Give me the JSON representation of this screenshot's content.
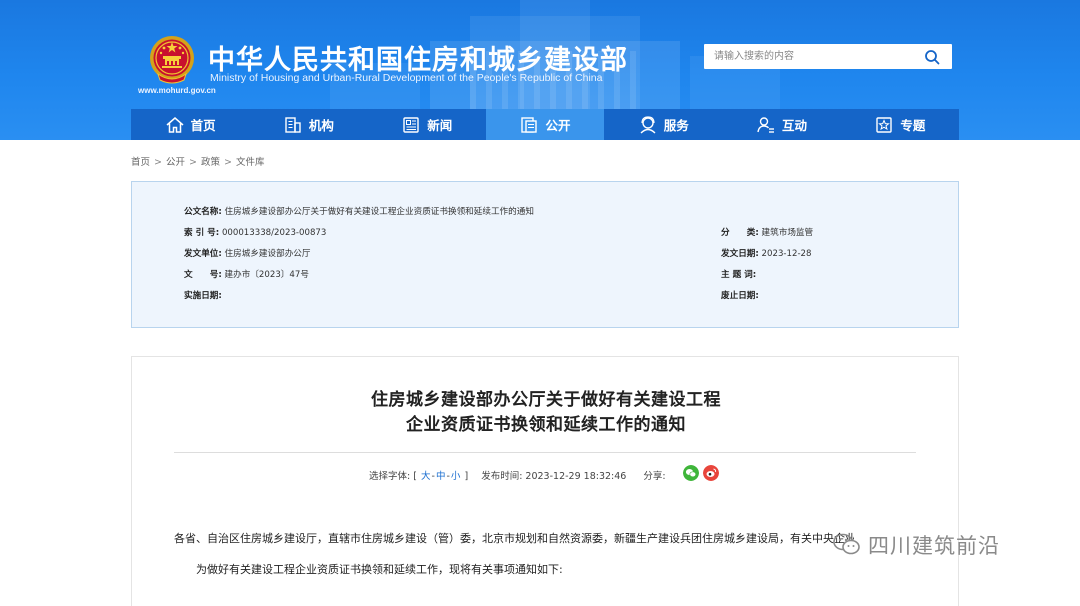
{
  "header": {
    "site_title": "中华人民共和国住房和城乡建设部",
    "site_subtitle": "Ministry of Housing and Urban-Rural Development of the People's Republic of China",
    "site_url": "www.mohurd.gov.cn",
    "search_placeholder": "请输入搜索的内容"
  },
  "nav": {
    "items": [
      {
        "label": "首页",
        "icon": "home-icon"
      },
      {
        "label": "机构",
        "icon": "building-icon"
      },
      {
        "label": "新闻",
        "icon": "news-icon"
      },
      {
        "label": "公开",
        "icon": "document-icon",
        "active": true
      },
      {
        "label": "服务",
        "icon": "service-icon"
      },
      {
        "label": "互动",
        "icon": "user-interaction-icon"
      },
      {
        "label": "专题",
        "icon": "star-icon"
      }
    ]
  },
  "breadcrumb": [
    "首页",
    "公开",
    "政策",
    "文件库"
  ],
  "info": {
    "title_label": "公文名称:",
    "title_value": "住房城乡建设部办公厅关于做好有关建设工程企业资质证书换领和延续工作的通知",
    "index_label": "索 引 号:",
    "index_value": "000013338/2023-00873",
    "category_label": "分　　类:",
    "category_value": "建筑市场监管",
    "issuer_label": "发文单位:",
    "issuer_value": "住房城乡建设部办公厅",
    "date_label": "发文日期:",
    "date_value": "2023-12-28",
    "docno_label": "文　　号:",
    "docno_value": "建办市〔2023〕47号",
    "topic_label": "主 题 词:",
    "topic_value": "",
    "effective_label": "实施日期:",
    "effective_value": "",
    "abolish_label": "废止日期:",
    "abolish_value": ""
  },
  "article": {
    "title_line1": "住房城乡建设部办公厅关于做好有关建设工程",
    "title_line2": "企业资质证书换领和延续工作的通知",
    "font_label": "选择字体:",
    "font_bracket_open": "[",
    "font_large": "大",
    "font_medium": "中",
    "font_small": "小",
    "font_bracket_close": "]",
    "publish_label": "发布时间:",
    "publish_time": "2023-12-29 18:32:46",
    "share_label": "分享:",
    "para1": "各省、自治区住房城乡建设厅，直辖市住房城乡建设（管）委，北京市规划和自然资源委，新疆生产建设兵团住房城乡建设局，有关中央企业：",
    "para2": "为做好有关建设工程企业资质证书换领和延续工作，现将有关事项通知如下:"
  },
  "watermark": {
    "text": "四川建筑前沿"
  },
  "colors": {
    "header_blue": "#1f86ee",
    "nav_blue": "#1565c8",
    "nav_active": "#3a95ec",
    "info_bg": "#eef5fd",
    "link_blue": "#1d6fd0"
  }
}
